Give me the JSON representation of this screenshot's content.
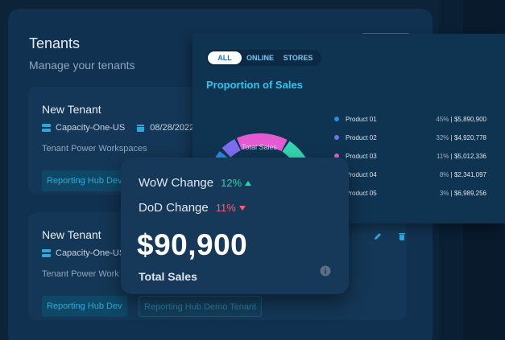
{
  "tenants": {
    "title": "Tenants",
    "subtitle": "Manage your tenants",
    "cards": [
      {
        "title": "New Tenant",
        "capacity": "Capacity-One-US",
        "date": "08/28/2022",
        "workspaces_label": "Tenant Power Workspaces",
        "chips": [
          "Reporting Hub Dev"
        ]
      },
      {
        "title": "New Tenant",
        "capacity": "Capacity-One-US",
        "workspaces_label": "Tenant Power Work",
        "chips": [
          "Reporting Hub Dev",
          "Reporting Hub Demo Tenant"
        ]
      }
    ]
  },
  "sales_panel": {
    "toggles": [
      "ALL",
      "ONLINE",
      "STORES"
    ],
    "active_toggle": "ALL",
    "title": "Proportion of Sales",
    "total_label": "Total Sales",
    "products": [
      {
        "name": "Product 01",
        "pct": "45%",
        "value": "$5,890,900",
        "color": "#2e88e5"
      },
      {
        "name": "Product 02",
        "pct": "32%",
        "value": "$4,920,778",
        "color": "#7c6ef0"
      },
      {
        "name": "Product 03",
        "pct": "11%",
        "value": "$5,012,336",
        "color": "#e45bd1"
      },
      {
        "name": "Product 04",
        "pct": "8%",
        "value": "$2,341,097",
        "color": "#33d6b0"
      },
      {
        "name": "Product 05",
        "pct": "3%",
        "value": "$6,989,256",
        "color": "#f0a04b"
      }
    ]
  },
  "metrics": {
    "wow_label": "WoW Change",
    "wow_value": "12%",
    "wow_direction": "up",
    "dod_label": "DoD Change",
    "dod_value": "11%",
    "dod_direction": "down",
    "total_value": "$90,900",
    "total_label": "Total Sales"
  },
  "colors": {
    "accent": "#29c7ef",
    "up": "#2ad6a6",
    "down": "#ff5a6e"
  }
}
